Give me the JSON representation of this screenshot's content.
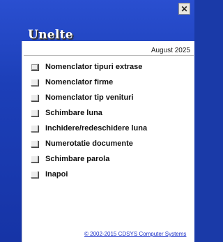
{
  "window": {
    "title": "Unelte",
    "close_glyph": "✕"
  },
  "header": {
    "period": "August 2025"
  },
  "menu": {
    "items": [
      {
        "label": "Nomenclator tipuri extrase"
      },
      {
        "label": "Nomenclator firme"
      },
      {
        "label": "Nomenclator tip venituri"
      },
      {
        "label": "Schimbare luna"
      },
      {
        "label": "Inchidere/redeschidere luna"
      },
      {
        "label": "Numerotatie documente"
      },
      {
        "label": "Schimbare parola"
      },
      {
        "label": "Inapoi"
      }
    ]
  },
  "footer": {
    "copyright": "© 2002-2015 CDSYS Computer Systems"
  },
  "colors": {
    "background": "#1c3fb8",
    "panel": "#ffffff",
    "link": "#1a2fc8"
  }
}
